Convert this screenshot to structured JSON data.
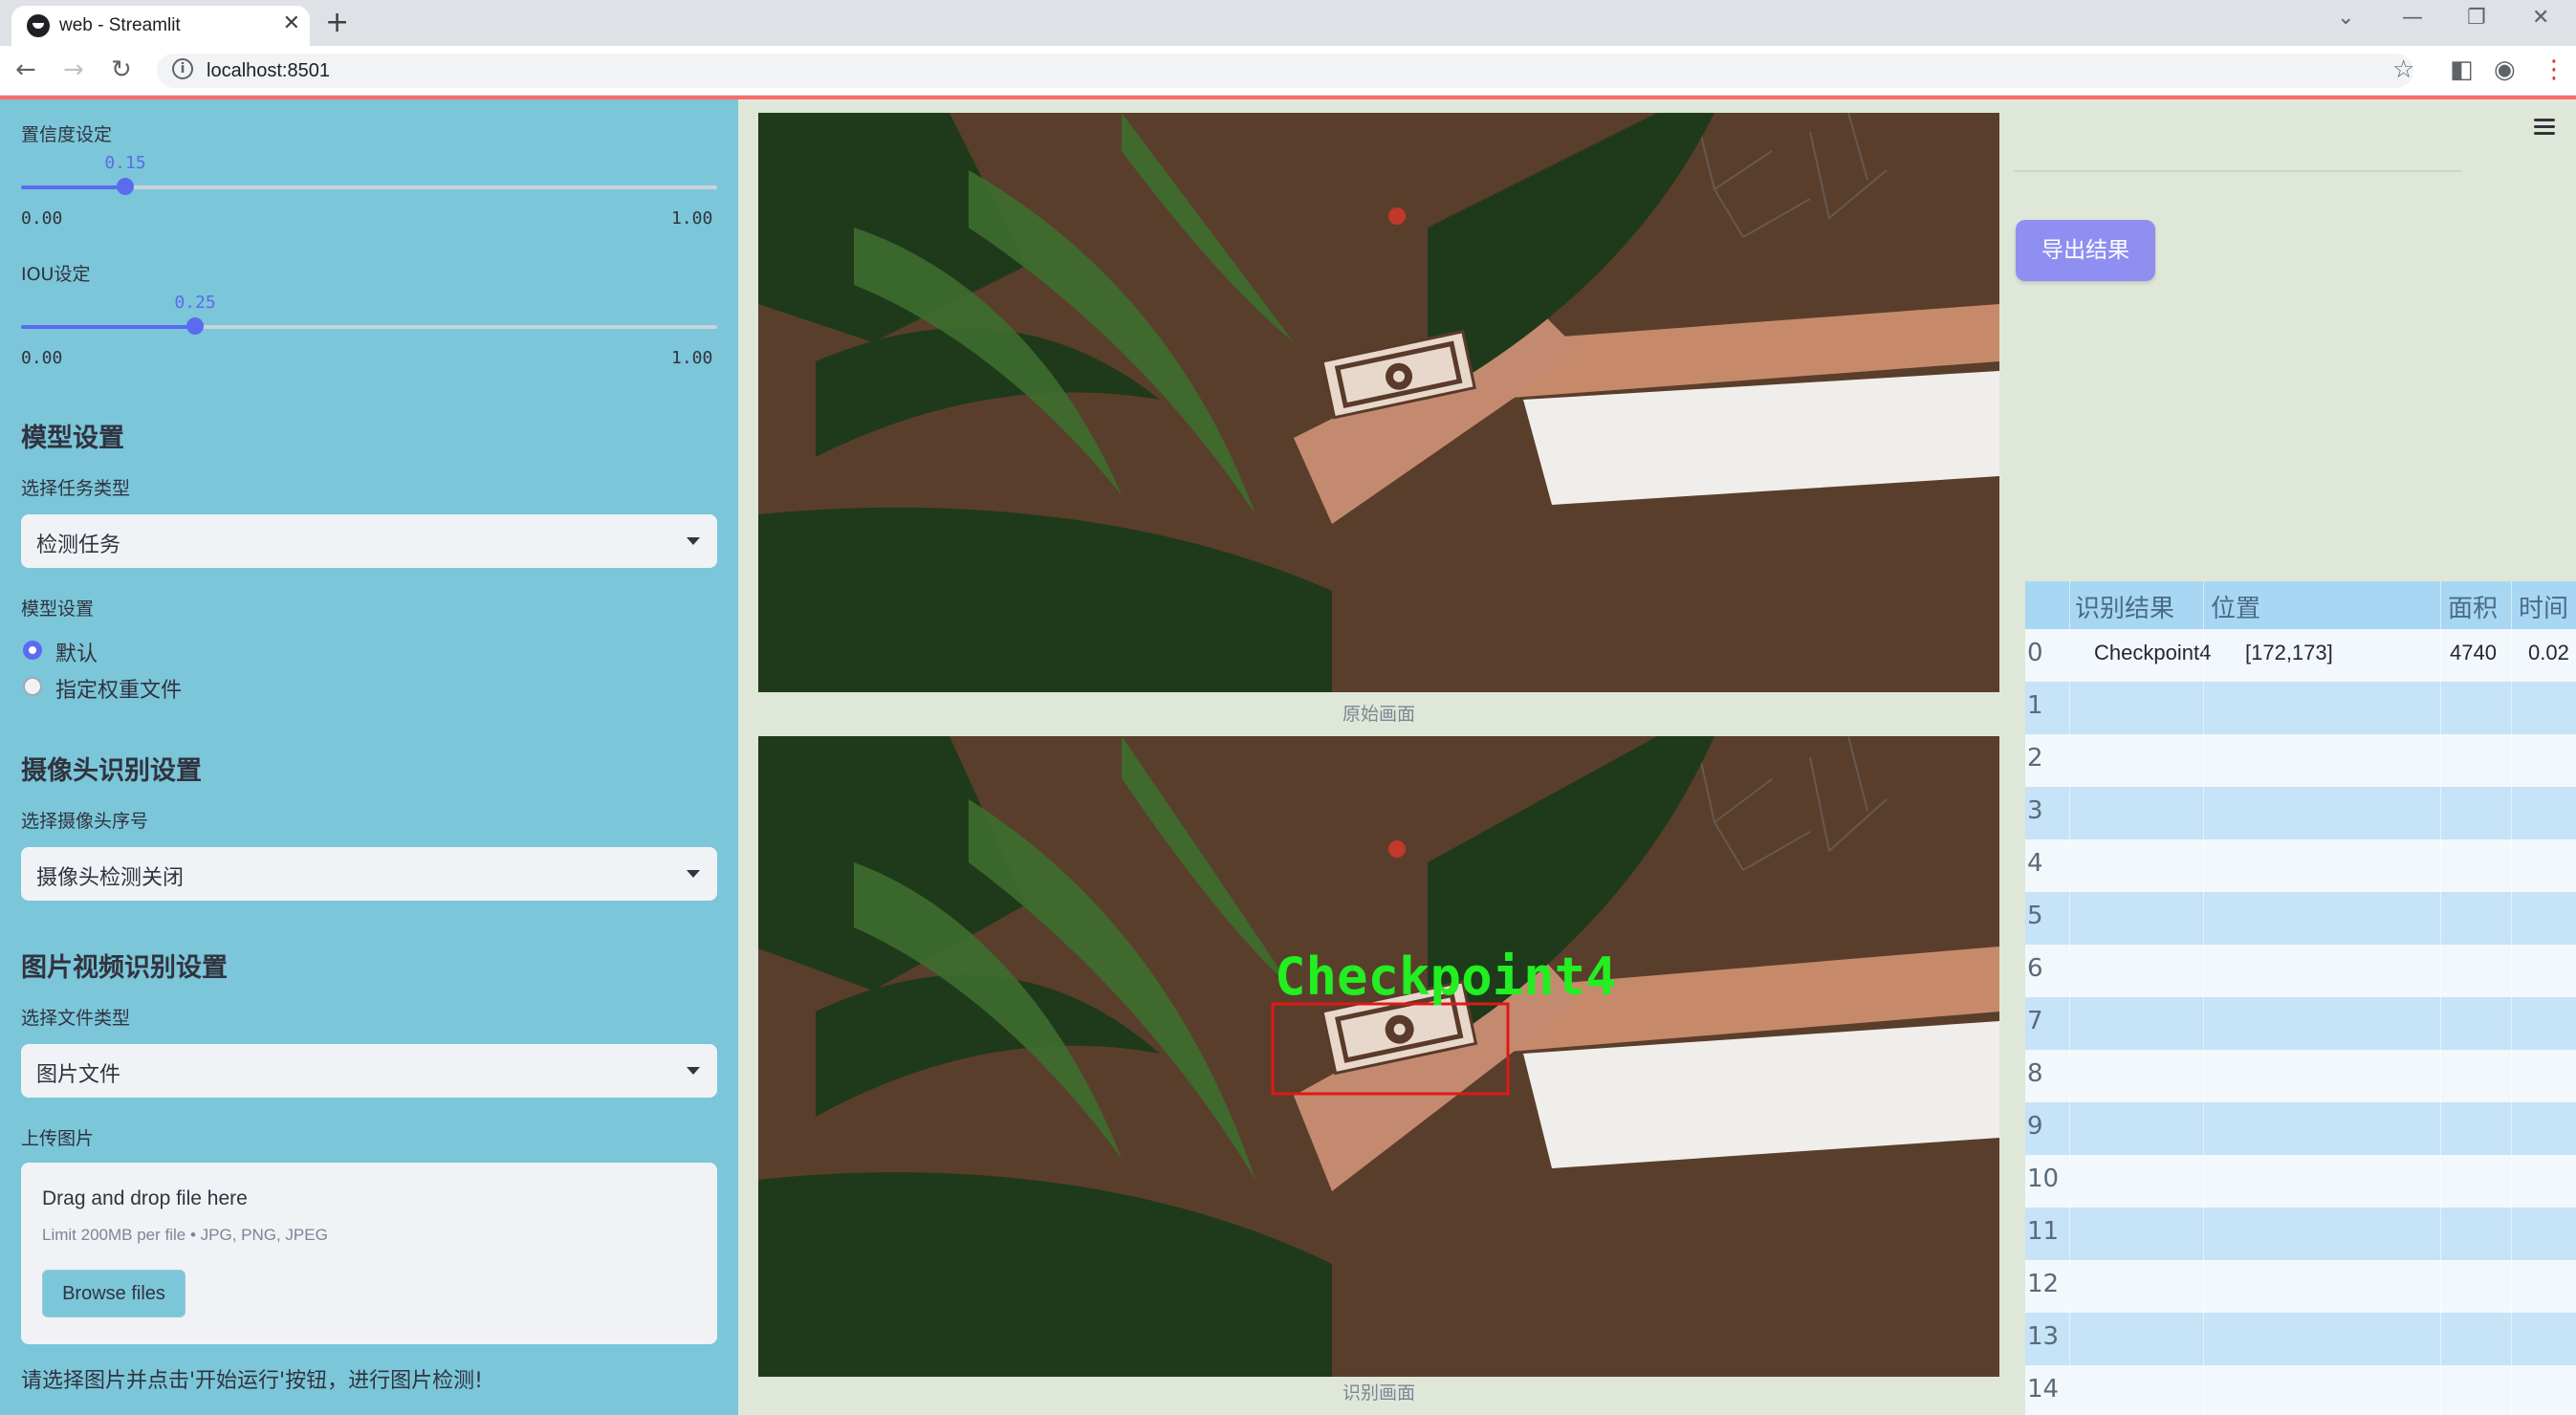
{
  "browser": {
    "tab_title": "web - Streamlit",
    "url": "localhost:8501"
  },
  "sidebar": {
    "confidence": {
      "label": "置信度设定",
      "value": "0.15",
      "value_num": 0.15,
      "min": "0.00",
      "max": "1.00"
    },
    "iou": {
      "label": "IOU设定",
      "value": "0.25",
      "value_num": 0.25,
      "min": "0.00",
      "max": "1.00"
    },
    "model_section": {
      "heading": "模型设置",
      "task_label": "选择任务类型",
      "task_value": "检测任务",
      "model_label": "模型设置",
      "options": [
        "默认",
        "指定权重文件"
      ],
      "selected_option": "默认"
    },
    "camera_section": {
      "heading": "摄像头识别设置",
      "camera_label": "选择摄像头序号",
      "camera_value": "摄像头检测关闭"
    },
    "media_section": {
      "heading": "图片视频识别设置",
      "file_type_label": "选择文件类型",
      "file_type_value": "图片文件",
      "upload_label": "上传图片",
      "drop_text": "Drag and drop file here",
      "limit_text": "Limit 200MB per file • JPG, PNG, JPEG",
      "browse_label": "Browse files"
    },
    "footer_text": "请选择图片并点击'开始运行'按钮，进行图片检测!"
  },
  "main": {
    "original_caption": "原始画面",
    "result_caption": "识别画面",
    "detection_label": "Checkpoint4"
  },
  "right_panel": {
    "export_label": "导出结果",
    "table": {
      "headers": [
        "识别结果",
        "位置",
        "面积",
        "时间"
      ],
      "rows": [
        {
          "index": "0",
          "result": "Checkpoint4",
          "position": "[172,173]",
          "area": "4740",
          "time": "0.02"
        },
        {
          "index": "1"
        },
        {
          "index": "2"
        },
        {
          "index": "3"
        },
        {
          "index": "4"
        },
        {
          "index": "5"
        },
        {
          "index": "6"
        },
        {
          "index": "7"
        },
        {
          "index": "8"
        },
        {
          "index": "9"
        },
        {
          "index": "10"
        },
        {
          "index": "11"
        },
        {
          "index": "12"
        },
        {
          "index": "13"
        },
        {
          "index": "14"
        }
      ]
    }
  },
  "colors": {
    "sidebar_bg": "#7bc6d9",
    "accent": "#5b6bf0",
    "export_button": "#8e8ff0",
    "detection_box": "#e01818",
    "detection_text": "#22ee22"
  }
}
